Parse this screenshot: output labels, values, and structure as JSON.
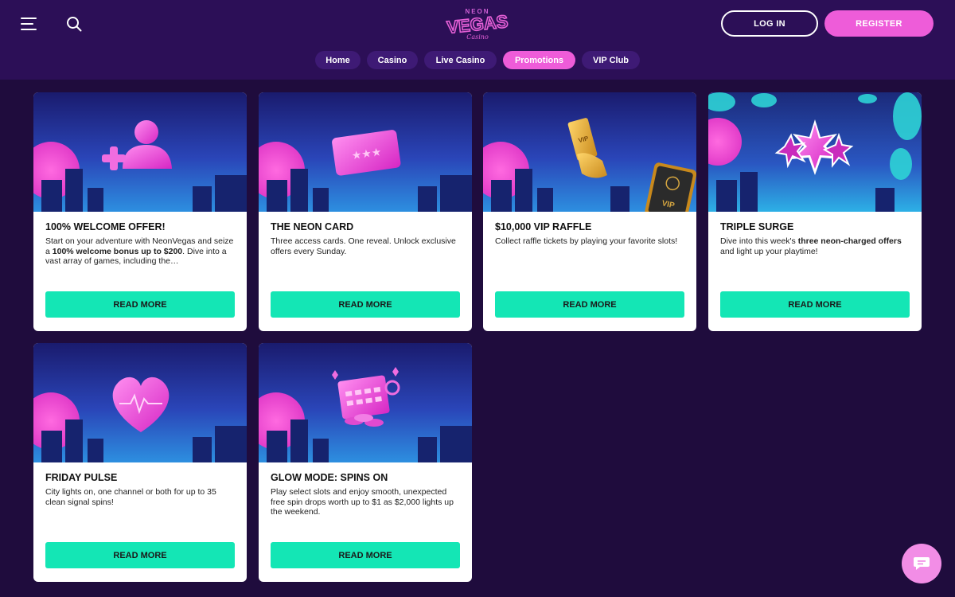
{
  "header": {
    "logo": {
      "top": "NEON",
      "main": "VEGAS",
      "sub": "Casino"
    },
    "login_label": "LOG IN",
    "register_label": "REGISTER",
    "tabs": [
      {
        "label": "Home",
        "active": false
      },
      {
        "label": "Casino",
        "active": false
      },
      {
        "label": "Live Casino",
        "active": false
      },
      {
        "label": "Promotions",
        "active": true
      },
      {
        "label": "VIP Club",
        "active": false
      }
    ]
  },
  "promotions": [
    {
      "title": "100% WELCOME OFFER!",
      "desc_parts": [
        "Start on your adventure with NeonVegas and seize a ",
        "100% welcome bonus up to $200",
        ". Dive into a vast array of games, including the…"
      ],
      "button": "READ MORE",
      "icon": "user-plus-icon"
    },
    {
      "title": "THE NEON CARD",
      "desc_parts": [
        "Three access cards. One reveal. Unlock exclusive offers every Sunday."
      ],
      "button": "READ MORE",
      "icon": "neon-card-icon"
    },
    {
      "title": "$10,000 VIP RAFFLE",
      "desc_parts": [
        "Collect raffle tickets by playing your favorite slots!"
      ],
      "button": "READ MORE",
      "icon": "vip-ticket-icon"
    },
    {
      "title": "TRIPLE SURGE",
      "desc_parts": [
        "Dive into this week's ",
        "three neon-charged offers",
        " and light up your playtime!"
      ],
      "button": "READ MORE",
      "icon": "triple-star-icon"
    },
    {
      "title": "FRIDAY PULSE",
      "desc_parts": [
        "City lights on, one channel or both for up to 35 clean signal spins!"
      ],
      "button": "READ MORE",
      "icon": "heart-pulse-icon"
    },
    {
      "title": "GLOW MODE: SPINS ON",
      "desc_parts": [
        "Play select slots and enjoy smooth, unexpected free spin drops worth up to $1 as $2,000 lights up the weekend."
      ],
      "button": "READ MORE",
      "icon": "calendar-coins-icon"
    }
  ],
  "colors": {
    "accent_pink": "#ee5cd9",
    "button_teal": "#14e6b5",
    "header_bg": "#2c0f57",
    "page_bg": "#1f0c3d"
  },
  "chat": {
    "icon": "chat-icon"
  }
}
